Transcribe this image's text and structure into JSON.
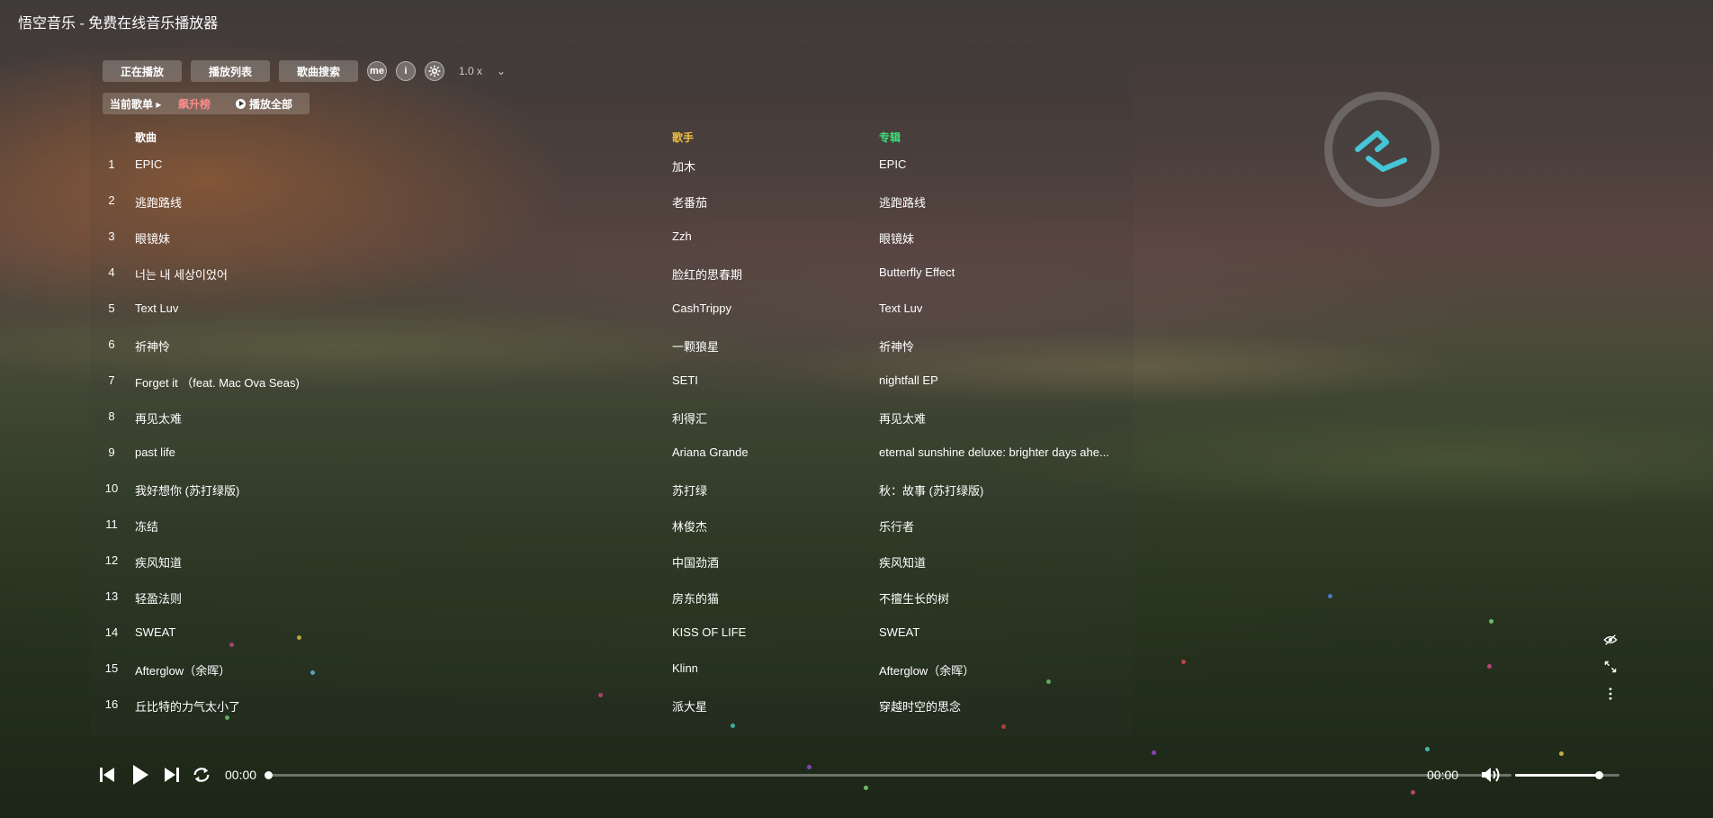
{
  "window": {
    "title": "悟空音乐 - 免费在线音乐播放器"
  },
  "toolbar": {
    "now_playing": "正在播放",
    "playlist": "播放列表",
    "song_search": "歌曲搜索",
    "me_icon_text": "me",
    "info_icon_text": "i",
    "speed": "1.0 x",
    "speed_chevron": "⌄"
  },
  "subbar": {
    "current_list_label": "当前歌单",
    "current_list_arrow": "▸",
    "list_name": "飙升榜",
    "play_all": "播放全部"
  },
  "table": {
    "headers": {
      "song": "歌曲",
      "artist": "歌手",
      "album": "专辑"
    },
    "header_colors": {
      "song": "#ffffff",
      "artist": "#f0c040",
      "album": "#3ee07a"
    },
    "rows": [
      {
        "num": "1",
        "song": "EPIC",
        "artist": "加木",
        "album": "EPIC"
      },
      {
        "num": "2",
        "song": "逃跑路线",
        "artist": "老番茄",
        "album": "逃跑路线"
      },
      {
        "num": "3",
        "song": "眼镜妹",
        "artist": "Zzh",
        "album": "眼镜妹"
      },
      {
        "num": "4",
        "song": "너는 내 세상이었어",
        "artist": "脸红的思春期",
        "album": "Butterfly Effect"
      },
      {
        "num": "5",
        "song": "Text Luv",
        "artist": "CashTrippy",
        "album": "Text Luv"
      },
      {
        "num": "6",
        "song": "祈神怜",
        "artist": "一颗狼星",
        "album": "祈神怜"
      },
      {
        "num": "7",
        "song": "Forget it （feat. Mac Ova Seas)",
        "artist": "SETI",
        "album": "nightfall EP"
      },
      {
        "num": "8",
        "song": "再见太难",
        "artist": "利得汇",
        "album": "再见太难"
      },
      {
        "num": "9",
        "song": "past life",
        "artist": "Ariana Grande",
        "album": "eternal sunshine deluxe: brighter days ahe..."
      },
      {
        "num": "10",
        "song": "我好想你 (苏打绿版)",
        "artist": "苏打绿",
        "album": "秋：故事 (苏打绿版)"
      },
      {
        "num": "11",
        "song": "冻结",
        "artist": "林俊杰",
        "album": "乐行者"
      },
      {
        "num": "12",
        "song": "疾风知道",
        "artist": "中国劲酒",
        "album": "疾风知道"
      },
      {
        "num": "13",
        "song": "轻盈法则",
        "artist": "房东的猫",
        "album": "不擅生长的树"
      },
      {
        "num": "14",
        "song": "SWEAT",
        "artist": "KISS OF LIFE",
        "album": "SWEAT"
      },
      {
        "num": "15",
        "song": "Afterglow（余晖）",
        "artist": "Klinn",
        "album": "Afterglow（余晖）"
      },
      {
        "num": "16",
        "song": "丘比特的力气太小了",
        "artist": "派大星",
        "album": "穿越时空的思念"
      }
    ]
  },
  "player": {
    "current_time": "00:00",
    "total_time": "00:00",
    "progress": 0,
    "volume": 0.8
  },
  "colors": {
    "accent": "#44c6d6"
  }
}
